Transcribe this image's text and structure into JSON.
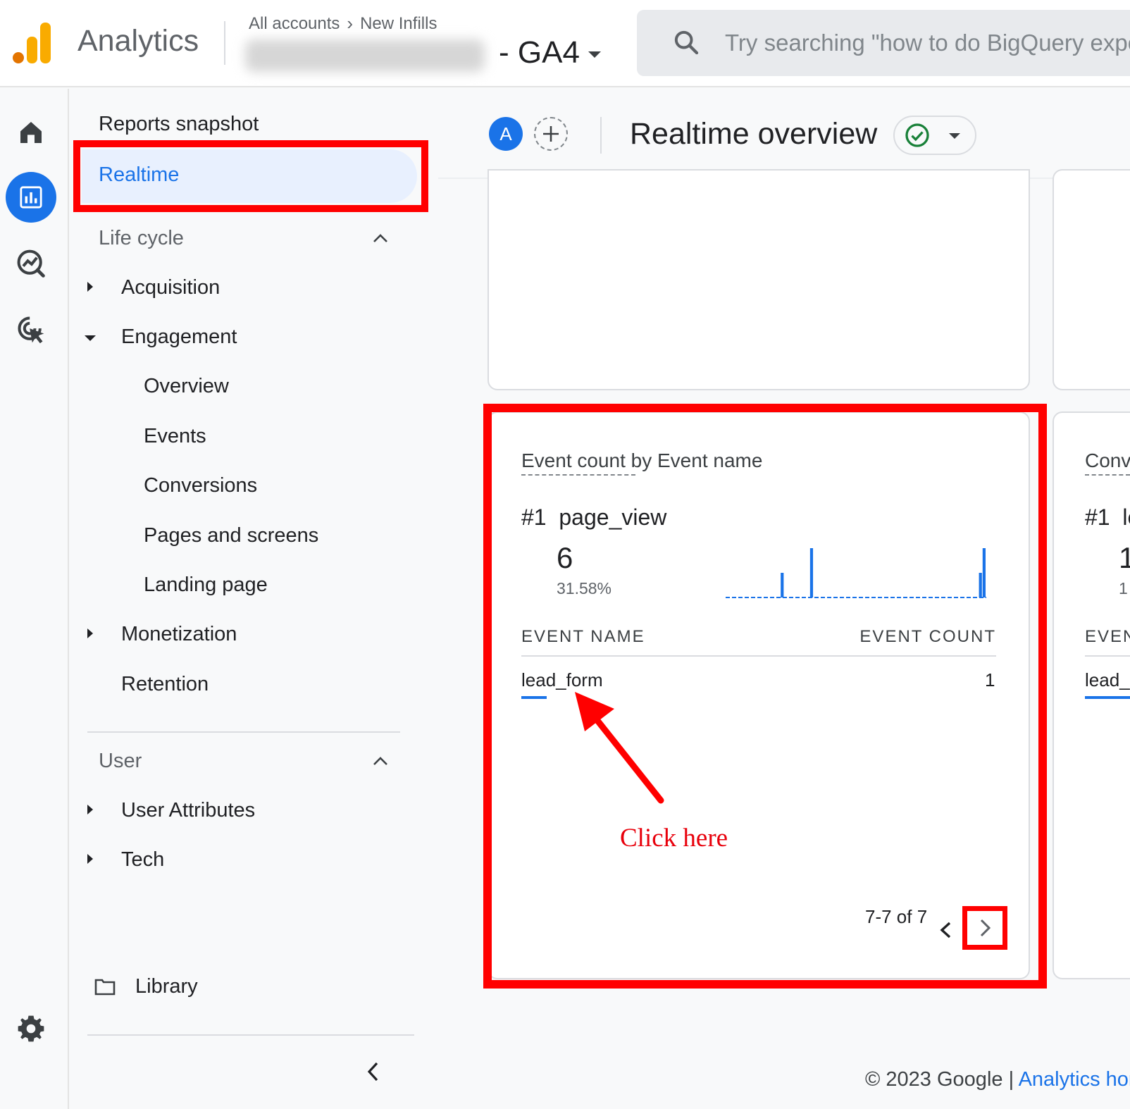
{
  "app": {
    "title": "Analytics",
    "breadcrumb": [
      "All accounts",
      "New Infills"
    ],
    "property_suffix": "- GA4",
    "search_placeholder": "Try searching \"how to do BigQuery export\""
  },
  "rail": {
    "items": [
      {
        "name": "home",
        "icon": "home-icon",
        "active": false
      },
      {
        "name": "reports",
        "icon": "bar-chart-icon",
        "active": true
      },
      {
        "name": "explore",
        "icon": "explore-icon",
        "active": false
      },
      {
        "name": "advertising",
        "icon": "advertising-icon",
        "active": false
      }
    ],
    "settings_icon": "gear-icon"
  },
  "sidebar": {
    "reports_snapshot": "Reports snapshot",
    "realtime": "Realtime",
    "life_cycle": "Life cycle",
    "acquisition": "Acquisition",
    "engagement": "Engagement",
    "engagement_items": [
      "Overview",
      "Events",
      "Conversions",
      "Pages and screens",
      "Landing page"
    ],
    "monetization": "Monetization",
    "retention": "Retention",
    "user": "User",
    "user_attributes": "User Attributes",
    "tech": "Tech",
    "library": "Library"
  },
  "header": {
    "avatar_letter": "A",
    "title": "Realtime overview"
  },
  "event_card": {
    "title": "Event count by Event name",
    "rank": "#1",
    "top_event": "page_view",
    "top_value": "6",
    "top_percent": "31.58%",
    "col_name": "EVENT NAME",
    "col_count": "EVENT COUNT",
    "rows": [
      {
        "name": "lead_form",
        "count": "1"
      }
    ],
    "pager": "7-7 of 7"
  },
  "conversions_card": {
    "title": "Conv",
    "rank": "#1",
    "top_event": "le",
    "top_value": "1",
    "top_percent": "1",
    "col_name": "EVEN",
    "row": "lead_"
  },
  "chart_data": {
    "type": "bar",
    "title": "",
    "values": [
      0,
      0,
      0,
      0,
      0,
      0,
      0,
      0,
      0,
      0,
      0,
      0,
      0,
      0,
      0,
      2,
      0,
      0,
      0,
      0,
      0,
      0,
      0,
      4,
      0,
      0,
      0,
      0,
      0,
      0,
      0,
      0,
      0,
      0,
      0,
      0,
      0,
      0,
      0,
      0,
      0,
      0,
      0,
      0,
      0,
      0,
      0,
      0,
      0,
      0,
      0,
      0,
      0,
      0,
      0,
      0,
      0,
      0,
      0,
      0,
      0,
      0,
      0,
      0,
      0,
      0,
      0,
      0,
      0,
      2,
      4
    ],
    "ylim": [
      0,
      4
    ],
    "color": "#1a73e8"
  },
  "annotation": {
    "text": "Click here",
    "color": "#ff0000"
  },
  "footer": {
    "copyright": "© 2023 Google | ",
    "link": "Analytics home"
  }
}
